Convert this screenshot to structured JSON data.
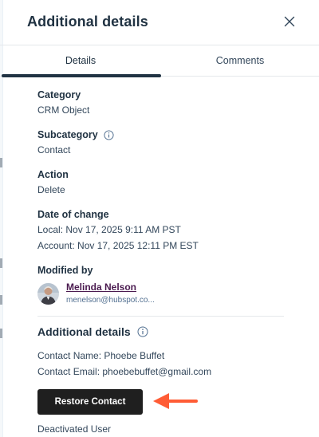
{
  "panel": {
    "title": "Additional details"
  },
  "tabs": [
    {
      "label": "Details",
      "active": true
    },
    {
      "label": "Comments",
      "active": false
    }
  ],
  "fields": {
    "category": {
      "label": "Category",
      "value": "CRM Object"
    },
    "subcategory": {
      "label": "Subcategory",
      "value": "Contact"
    },
    "action": {
      "label": "Action",
      "value": "Delete"
    },
    "date_of_change": {
      "label": "Date of change",
      "local": "Local: Nov 17, 2025 9:11 AM PST",
      "account": "Account: Nov 17, 2025 12:11 PM EST"
    },
    "modified_by": {
      "label": "Modified by",
      "name": "Melinda Nelson",
      "email": "menelson@hubspot.co..."
    }
  },
  "additional_details": {
    "title": "Additional details",
    "lines": [
      "Contact Name: Phoebe Buffet",
      "Contact Email: phoebebuffet@gmail.com"
    ]
  },
  "restore_button": {
    "label": "Restore Contact"
  },
  "footer": {
    "status": "Deactivated User"
  },
  "colors": {
    "heading": "#213343",
    "body": "#33475b",
    "link": "#4a1a4f",
    "button_bg": "#1f1f1f",
    "arrow": "#ff5c35",
    "divider": "#e5e8eb"
  },
  "icons": {
    "close": "close-icon",
    "info": "info-icon",
    "avatar": "avatar",
    "annotation": "arrow-icon"
  }
}
